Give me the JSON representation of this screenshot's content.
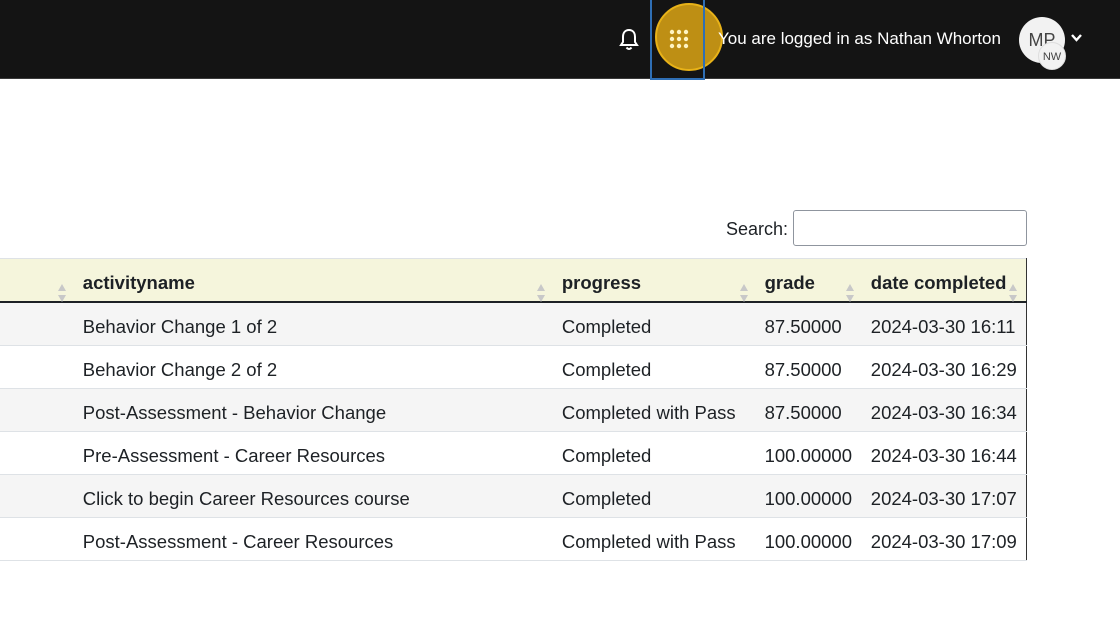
{
  "navbar": {
    "logged_in_text": "You are logged in as Nathan Whorton",
    "avatar_text": "MP",
    "avatar_initials": "NW",
    "icons": [
      "bell-icon",
      "apps-grid-icon",
      "chevron-down-icon"
    ],
    "highlight_color": "#e8b218"
  },
  "search": {
    "label": "Search:",
    "value": ""
  },
  "table": {
    "headers": [
      "",
      "activityname",
      "progress",
      "grade",
      "date completed"
    ],
    "rows": [
      {
        "activity": "Behavior Change 1 of 2",
        "progress": "Completed",
        "grade": "87.50000",
        "date": "2024-03-30 16:11"
      },
      {
        "activity": "Behavior Change 2 of 2",
        "progress": "Completed",
        "grade": "87.50000",
        "date": "2024-03-30 16:29"
      },
      {
        "activity": "Post-Assessment - Behavior Change",
        "progress": "Completed with Pass",
        "grade": "87.50000",
        "date": "2024-03-30 16:34"
      },
      {
        "activity": "Pre-Assessment - Career Resources",
        "progress": "Completed",
        "grade": "100.00000",
        "date": "2024-03-30 16:44"
      },
      {
        "activity": "Click to begin Career Resources course",
        "progress": "Completed",
        "grade": "100.00000",
        "date": "2024-03-30 17:07"
      },
      {
        "activity": "Post-Assessment - Career Resources",
        "progress": "Completed with Pass",
        "grade": "100.00000",
        "date": "2024-03-30 17:09"
      }
    ]
  }
}
